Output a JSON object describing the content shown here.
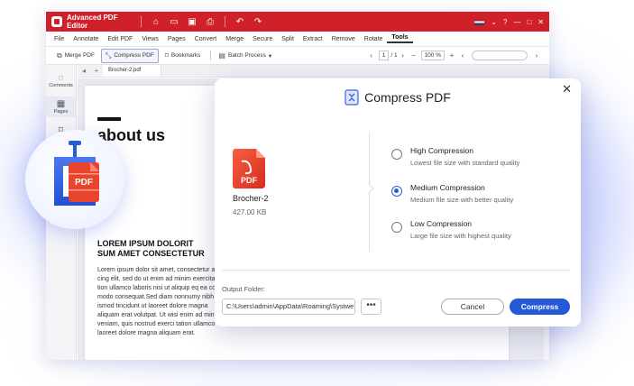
{
  "app": {
    "title": "Advanced PDF Editor",
    "menu": [
      "File",
      "Annotate",
      "Edit PDF",
      "Views",
      "Pages",
      "Convert",
      "Merge",
      "Secure",
      "Split",
      "Extract",
      "Remove",
      "Rotate",
      "Tools"
    ],
    "active_menu": "Tools",
    "toolbar": {
      "merge_pdf": "Merge PDF",
      "compress_pdf": "Compress PDF",
      "bookmarks": "Bookmarks",
      "batch_process": "Batch Process"
    },
    "pager": {
      "current": "1",
      "total": "/ 1",
      "zoom": "100 %"
    },
    "sidebar": {
      "comments": "Comments",
      "pages": "Pages"
    },
    "tab": {
      "doc_name": "Brocher-2.pdf"
    },
    "document": {
      "title": "about us",
      "heading": "LOREM IPSUM DOLORIT\nSUM AMET CONSECTETUR",
      "body": "Lorem ipsum dolor sit amet, consectetur ac\ncing elit, sed do ut enim ad minim exercita\ntion ullamco laboris nisi ut aliquip eq ea com\nmodo consequat.Sed diam nonnumy nibh\nismod tincidunt ut laoreet dolore magna\naliquam erat volutpat. Ut wisi enim ad minim\nveniam, quis nostrud exerci tation ullamco\nlaoreet dolore magna aliquam erat."
    }
  },
  "dialog": {
    "title": "Compress PDF",
    "file": {
      "name": "Brocher-2",
      "size": "427.00 KB",
      "badge": "PDF"
    },
    "options": [
      {
        "title": "High Compression",
        "desc": "Lowest file size with standard quality",
        "checked": false
      },
      {
        "title": "Medium Compression",
        "desc": "Medium file size with better quality",
        "checked": true
      },
      {
        "title": "Low Compression",
        "desc": "Large file size with highest quality",
        "checked": false
      }
    ],
    "output_label": "Output Folder:",
    "output_path": "C:\\Users\\admin\\AppData\\Roaming\\Systwe",
    "browse_label": "•••",
    "cancel_label": "Cancel",
    "compress_label": "Compress"
  },
  "float_icon": {
    "badge": "PDF"
  },
  "colors": {
    "titlebar": "#d0202a",
    "accent": "#2358d6",
    "pdf_red": "#e8452c"
  }
}
